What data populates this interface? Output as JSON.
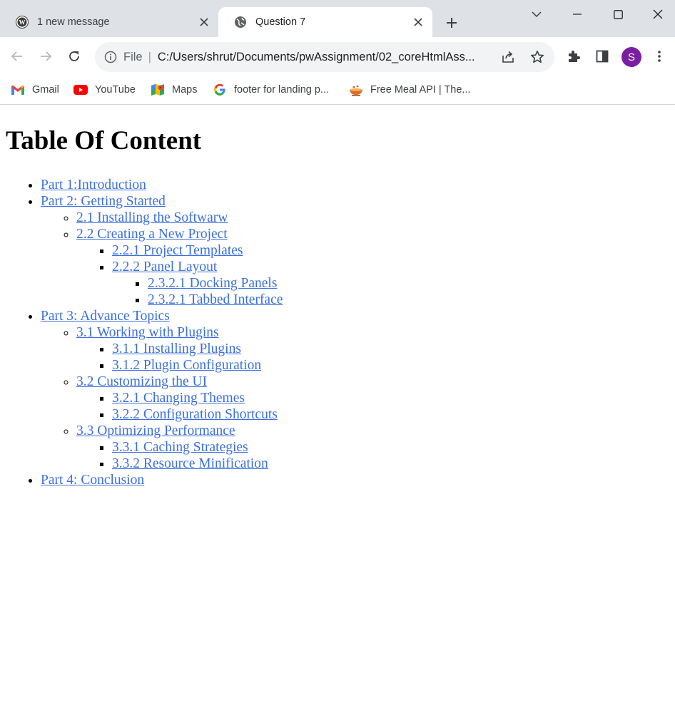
{
  "browser": {
    "tabs": [
      {
        "title": "1 new message",
        "active": false,
        "icon": "wordpress-icon"
      },
      {
        "title": "Question 7",
        "active": true,
        "icon": "globe-icon"
      }
    ],
    "address_bar": {
      "scheme_label": "File",
      "url": "C:/Users/shrut/Documents/pwAssignment/02_coreHtmlAss..."
    },
    "profile_initial": "S",
    "bookmarks": [
      {
        "label": "Gmail",
        "icon": "gmail-icon"
      },
      {
        "label": "YouTube",
        "icon": "youtube-icon"
      },
      {
        "label": "Maps",
        "icon": "maps-icon"
      },
      {
        "label": "footer for landing p...",
        "icon": "google-icon"
      },
      {
        "label": "Free Meal API | The...",
        "icon": "meal-icon"
      }
    ]
  },
  "page": {
    "heading": "Table Of Content",
    "toc": [
      {
        "label": "Part 1:Introduction",
        "children": []
      },
      {
        "label": "Part 2: Getting Started",
        "children": [
          {
            "label": "2.1 Installing the Softwarw",
            "children": []
          },
          {
            "label": "2.2 Creating a New Project",
            "children": [
              {
                "label": "2.2.1 Project Templates",
                "children": []
              },
              {
                "label": "2.2.2 Panel Layout",
                "children": [
                  {
                    "label": "2.3.2.1 Docking Panels"
                  },
                  {
                    "label": "2.3.2.1 Tabbed Interface"
                  }
                ]
              }
            ]
          }
        ]
      },
      {
        "label": "Part 3: Advance Topics",
        "children": [
          {
            "label": "3.1 Working with Plugins",
            "children": [
              {
                "label": "3.1.1 Installing Plugins",
                "children": []
              },
              {
                "label": "3.1.2 Plugin Configuration",
                "children": []
              }
            ]
          },
          {
            "label": "3.2 Customizing the UI",
            "children": [
              {
                "label": "3.2.1 Changing Themes",
                "children": []
              },
              {
                "label": "3.2.2 Configuration Shortcuts",
                "children": []
              }
            ]
          },
          {
            "label": "3.3 Optimizing Performance",
            "children": [
              {
                "label": "3.3.1 Caching Strategies",
                "children": []
              },
              {
                "label": "3.3.2 Resource Minification",
                "children": []
              }
            ]
          }
        ]
      },
      {
        "label": "Part 4: Conclusion",
        "children": []
      }
    ]
  },
  "colors": {
    "link": "#3a6fe0",
    "tabstrip": "#dee1e6",
    "omnibox": "#f1f3f4",
    "avatar": "#7b1fa2"
  }
}
